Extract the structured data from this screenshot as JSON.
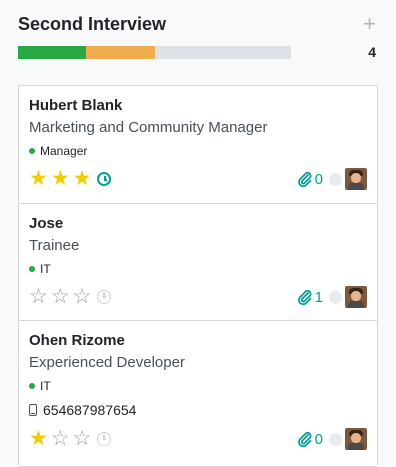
{
  "column": {
    "title": "Second Interview",
    "add_symbol": "+",
    "count": "4",
    "progress": [
      {
        "color": "#28a745",
        "fraction": 0.25
      },
      {
        "color": "#f0ad4e",
        "fraction": 0.25
      },
      {
        "color": "#dee2e6",
        "fraction": 0.5
      }
    ]
  },
  "cards": [
    {
      "name": "Hubert Blank",
      "job": "Marketing and Community Manager",
      "tag": "Manager",
      "phone": "",
      "stars": 3,
      "activity": "active",
      "attachments": "0"
    },
    {
      "name": "Jose",
      "job": "Trainee",
      "tag": "IT",
      "phone": "",
      "stars": 0,
      "activity": "inactive",
      "attachments": "1"
    },
    {
      "name": "Ohen Rizome",
      "job": "Experienced Developer",
      "tag": "IT",
      "phone": "654687987654",
      "stars": 1,
      "activity": "inactive",
      "attachments": "0"
    }
  ],
  "icons": {
    "add": "plus-icon",
    "star": "star-icon",
    "activity": "clock-icon",
    "attachment": "paperclip-icon",
    "phone": "mobile-phone-icon"
  },
  "colors": {
    "accent": "#00a09d",
    "star_on": "#f3cc00",
    "star_off": "#9aa0a6",
    "tag_dot": "#28a745"
  }
}
